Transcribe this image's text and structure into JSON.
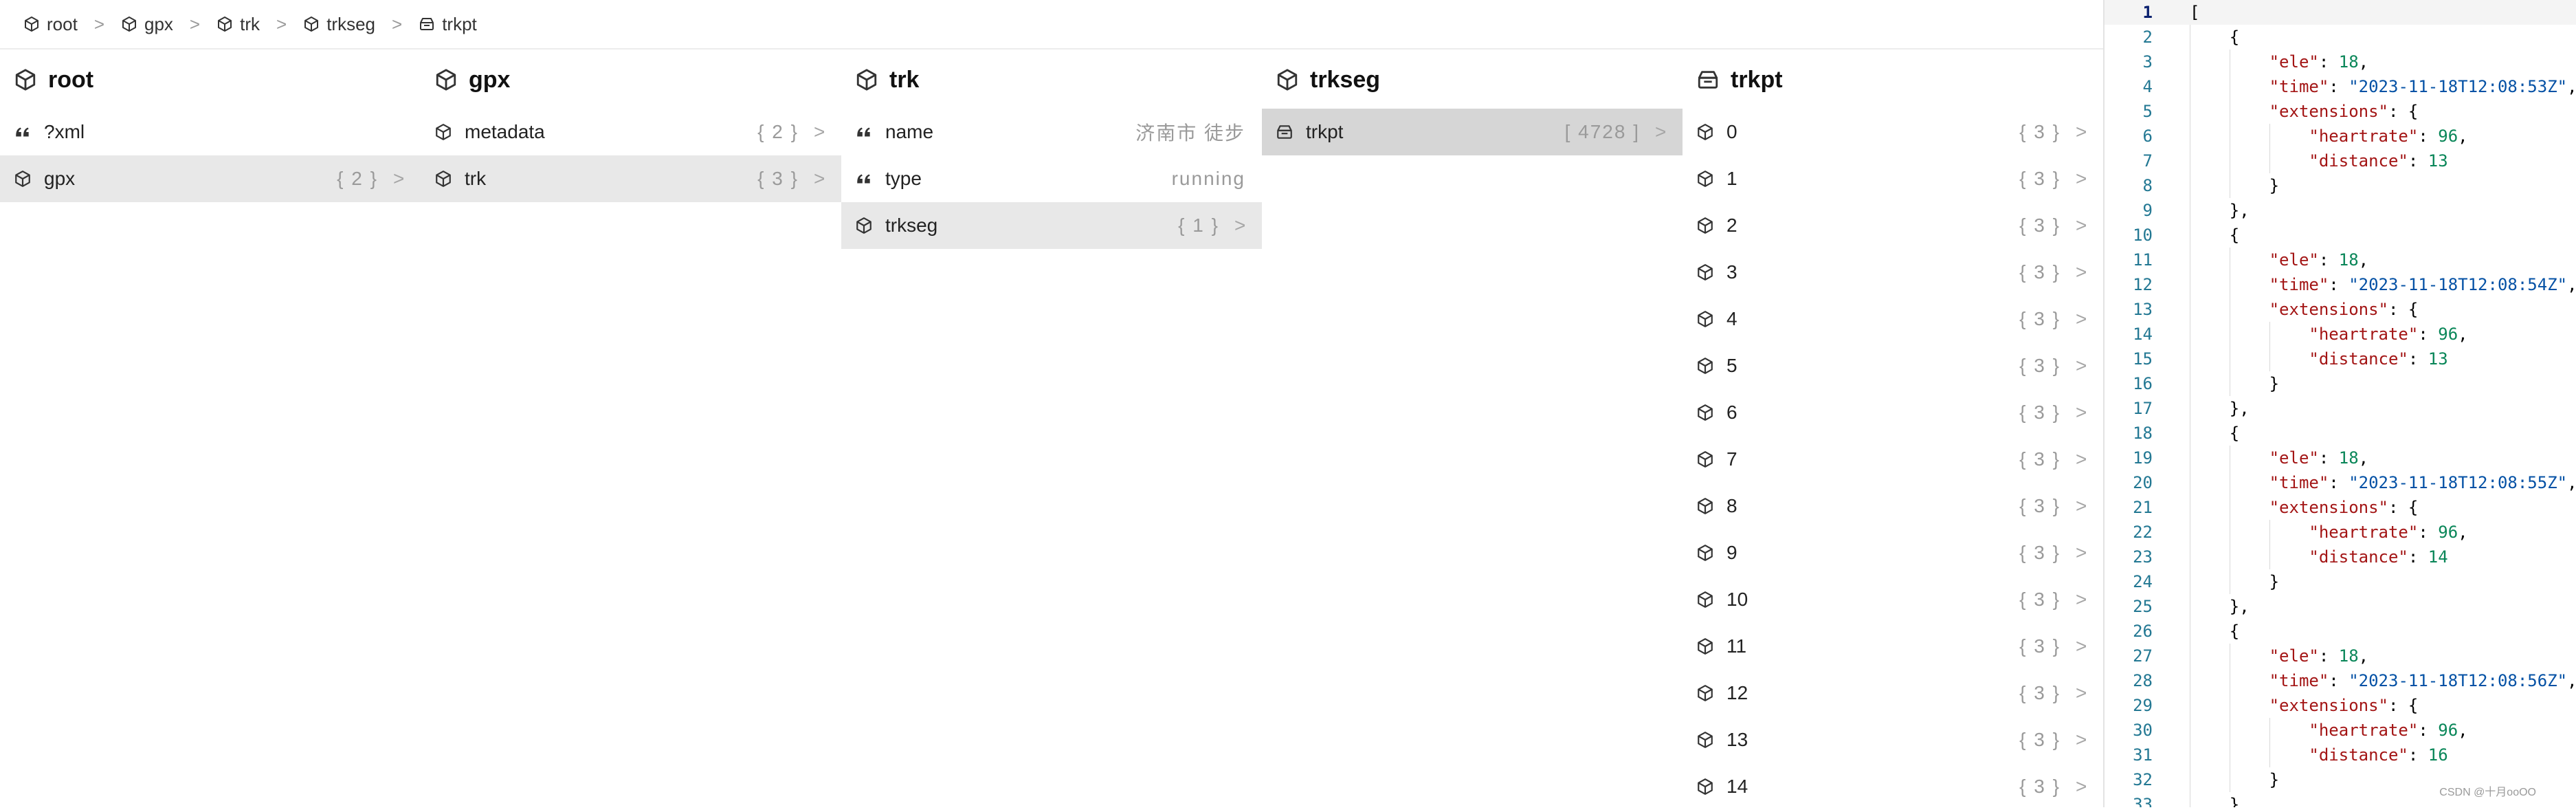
{
  "breadcrumb": [
    {
      "label": "root",
      "icon": "cube-icon"
    },
    {
      "label": "gpx",
      "icon": "cube-icon"
    },
    {
      "label": "trk",
      "icon": "cube-icon"
    },
    {
      "label": "trkseg",
      "icon": "cube-icon"
    },
    {
      "label": "trkpt",
      "icon": "stack-icon"
    }
  ],
  "breadcrumb_separator": ">",
  "columns": [
    {
      "title": "root",
      "icon": "cube-icon",
      "rows": [
        {
          "label": "?xml",
          "icon": "quote-icon",
          "meta": "",
          "chevron": false,
          "selected": ""
        },
        {
          "label": "gpx",
          "icon": "cube-icon",
          "meta": "{ 2 }",
          "chevron": true,
          "selected": "light"
        }
      ]
    },
    {
      "title": "gpx",
      "icon": "cube-icon",
      "rows": [
        {
          "label": "metadata",
          "icon": "cube-icon",
          "meta": "{ 2 }",
          "chevron": true,
          "selected": ""
        },
        {
          "label": "trk",
          "icon": "cube-icon",
          "meta": "{ 3 }",
          "chevron": true,
          "selected": "light"
        }
      ]
    },
    {
      "title": "trk",
      "icon": "cube-icon",
      "rows": [
        {
          "label": "name",
          "icon": "quote-icon",
          "meta": "济南市 徒步",
          "chevron": false,
          "selected": ""
        },
        {
          "label": "type",
          "icon": "quote-icon",
          "meta": "running",
          "chevron": false,
          "selected": ""
        },
        {
          "label": "trkseg",
          "icon": "cube-icon",
          "meta": "{ 1 }",
          "chevron": true,
          "selected": "light"
        }
      ]
    },
    {
      "title": "trkseg",
      "icon": "cube-icon",
      "rows": [
        {
          "label": "trkpt",
          "icon": "stack-icon",
          "meta": "[ 4728 ]",
          "chevron": true,
          "selected": "dark"
        }
      ]
    },
    {
      "title": "trkpt",
      "icon": "stack-icon",
      "rows": [
        {
          "label": "0",
          "icon": "cube-icon",
          "meta": "{ 3 }",
          "chevron": true,
          "selected": ""
        },
        {
          "label": "1",
          "icon": "cube-icon",
          "meta": "{ 3 }",
          "chevron": true,
          "selected": ""
        },
        {
          "label": "2",
          "icon": "cube-icon",
          "meta": "{ 3 }",
          "chevron": true,
          "selected": ""
        },
        {
          "label": "3",
          "icon": "cube-icon",
          "meta": "{ 3 }",
          "chevron": true,
          "selected": ""
        },
        {
          "label": "4",
          "icon": "cube-icon",
          "meta": "{ 3 }",
          "chevron": true,
          "selected": ""
        },
        {
          "label": "5",
          "icon": "cube-icon",
          "meta": "{ 3 }",
          "chevron": true,
          "selected": ""
        },
        {
          "label": "6",
          "icon": "cube-icon",
          "meta": "{ 3 }",
          "chevron": true,
          "selected": ""
        },
        {
          "label": "7",
          "icon": "cube-icon",
          "meta": "{ 3 }",
          "chevron": true,
          "selected": ""
        },
        {
          "label": "8",
          "icon": "cube-icon",
          "meta": "{ 3 }",
          "chevron": true,
          "selected": ""
        },
        {
          "label": "9",
          "icon": "cube-icon",
          "meta": "{ 3 }",
          "chevron": true,
          "selected": ""
        },
        {
          "label": "10",
          "icon": "cube-icon",
          "meta": "{ 3 }",
          "chevron": true,
          "selected": ""
        },
        {
          "label": "11",
          "icon": "cube-icon",
          "meta": "{ 3 }",
          "chevron": true,
          "selected": ""
        },
        {
          "label": "12",
          "icon": "cube-icon",
          "meta": "{ 3 }",
          "chevron": true,
          "selected": ""
        },
        {
          "label": "13",
          "icon": "cube-icon",
          "meta": "{ 3 }",
          "chevron": true,
          "selected": ""
        },
        {
          "label": "14",
          "icon": "cube-icon",
          "meta": "{ 3 }",
          "chevron": true,
          "selected": ""
        }
      ]
    }
  ],
  "row_chevron": ">",
  "code": {
    "active_line": 1,
    "lines": [
      {
        "n": "1",
        "indent": 0,
        "tokens": [
          [
            "p",
            "["
          ]
        ]
      },
      {
        "n": "2",
        "indent": 1,
        "tokens": [
          [
            "p",
            "{"
          ]
        ]
      },
      {
        "n": "3",
        "indent": 2,
        "tokens": [
          [
            "k",
            "\"ele\""
          ],
          [
            "p",
            ": "
          ],
          [
            "n",
            "18"
          ],
          [
            "p",
            ","
          ]
        ]
      },
      {
        "n": "4",
        "indent": 2,
        "tokens": [
          [
            "k",
            "\"time\""
          ],
          [
            "p",
            ": "
          ],
          [
            "s",
            "\"2023-11-18T12:08:53Z\""
          ],
          [
            "p",
            ","
          ]
        ]
      },
      {
        "n": "5",
        "indent": 2,
        "tokens": [
          [
            "k",
            "\"extensions\""
          ],
          [
            "p",
            ": {"
          ]
        ]
      },
      {
        "n": "6",
        "indent": 3,
        "tokens": [
          [
            "k",
            "\"heartrate\""
          ],
          [
            "p",
            ": "
          ],
          [
            "n",
            "96"
          ],
          [
            "p",
            ","
          ]
        ]
      },
      {
        "n": "7",
        "indent": 3,
        "tokens": [
          [
            "k",
            "\"distance\""
          ],
          [
            "p",
            ": "
          ],
          [
            "n",
            "13"
          ]
        ]
      },
      {
        "n": "8",
        "indent": 2,
        "tokens": [
          [
            "p",
            "}"
          ]
        ]
      },
      {
        "n": "9",
        "indent": 1,
        "tokens": [
          [
            "p",
            "},"
          ]
        ]
      },
      {
        "n": "10",
        "indent": 1,
        "tokens": [
          [
            "p",
            "{"
          ]
        ]
      },
      {
        "n": "11",
        "indent": 2,
        "tokens": [
          [
            "k",
            "\"ele\""
          ],
          [
            "p",
            ": "
          ],
          [
            "n",
            "18"
          ],
          [
            "p",
            ","
          ]
        ]
      },
      {
        "n": "12",
        "indent": 2,
        "tokens": [
          [
            "k",
            "\"time\""
          ],
          [
            "p",
            ": "
          ],
          [
            "s",
            "\"2023-11-18T12:08:54Z\""
          ],
          [
            "p",
            ","
          ]
        ]
      },
      {
        "n": "13",
        "indent": 2,
        "tokens": [
          [
            "k",
            "\"extensions\""
          ],
          [
            "p",
            ": {"
          ]
        ]
      },
      {
        "n": "14",
        "indent": 3,
        "tokens": [
          [
            "k",
            "\"heartrate\""
          ],
          [
            "p",
            ": "
          ],
          [
            "n",
            "96"
          ],
          [
            "p",
            ","
          ]
        ]
      },
      {
        "n": "15",
        "indent": 3,
        "tokens": [
          [
            "k",
            "\"distance\""
          ],
          [
            "p",
            ": "
          ],
          [
            "n",
            "13"
          ]
        ]
      },
      {
        "n": "16",
        "indent": 2,
        "tokens": [
          [
            "p",
            "}"
          ]
        ]
      },
      {
        "n": "17",
        "indent": 1,
        "tokens": [
          [
            "p",
            "},"
          ]
        ]
      },
      {
        "n": "18",
        "indent": 1,
        "tokens": [
          [
            "p",
            "{"
          ]
        ]
      },
      {
        "n": "19",
        "indent": 2,
        "tokens": [
          [
            "k",
            "\"ele\""
          ],
          [
            "p",
            ": "
          ],
          [
            "n",
            "18"
          ],
          [
            "p",
            ","
          ]
        ]
      },
      {
        "n": "20",
        "indent": 2,
        "tokens": [
          [
            "k",
            "\"time\""
          ],
          [
            "p",
            ": "
          ],
          [
            "s",
            "\"2023-11-18T12:08:55Z\""
          ],
          [
            "p",
            ","
          ]
        ]
      },
      {
        "n": "21",
        "indent": 2,
        "tokens": [
          [
            "k",
            "\"extensions\""
          ],
          [
            "p",
            ": {"
          ]
        ]
      },
      {
        "n": "22",
        "indent": 3,
        "tokens": [
          [
            "k",
            "\"heartrate\""
          ],
          [
            "p",
            ": "
          ],
          [
            "n",
            "96"
          ],
          [
            "p",
            ","
          ]
        ]
      },
      {
        "n": "23",
        "indent": 3,
        "tokens": [
          [
            "k",
            "\"distance\""
          ],
          [
            "p",
            ": "
          ],
          [
            "n",
            "14"
          ]
        ]
      },
      {
        "n": "24",
        "indent": 2,
        "tokens": [
          [
            "p",
            "}"
          ]
        ]
      },
      {
        "n": "25",
        "indent": 1,
        "tokens": [
          [
            "p",
            "},"
          ]
        ]
      },
      {
        "n": "26",
        "indent": 1,
        "tokens": [
          [
            "p",
            "{"
          ]
        ]
      },
      {
        "n": "27",
        "indent": 2,
        "tokens": [
          [
            "k",
            "\"ele\""
          ],
          [
            "p",
            ": "
          ],
          [
            "n",
            "18"
          ],
          [
            "p",
            ","
          ]
        ]
      },
      {
        "n": "28",
        "indent": 2,
        "tokens": [
          [
            "k",
            "\"time\""
          ],
          [
            "p",
            ": "
          ],
          [
            "s",
            "\"2023-11-18T12:08:56Z\""
          ],
          [
            "p",
            ","
          ]
        ]
      },
      {
        "n": "29",
        "indent": 2,
        "tokens": [
          [
            "k",
            "\"extensions\""
          ],
          [
            "p",
            ": {"
          ]
        ]
      },
      {
        "n": "30",
        "indent": 3,
        "tokens": [
          [
            "k",
            "\"heartrate\""
          ],
          [
            "p",
            ": "
          ],
          [
            "n",
            "96"
          ],
          [
            "p",
            ","
          ]
        ]
      },
      {
        "n": "31",
        "indent": 3,
        "tokens": [
          [
            "k",
            "\"distance\""
          ],
          [
            "p",
            ": "
          ],
          [
            "n",
            "16"
          ]
        ]
      },
      {
        "n": "32",
        "indent": 2,
        "tokens": [
          [
            "p",
            "}"
          ]
        ]
      },
      {
        "n": "33",
        "indent": 1,
        "tokens": [
          [
            "p",
            "},"
          ]
        ]
      }
    ]
  },
  "watermark": "CSDN @十月ooOO",
  "colors": {
    "selected_row": "#e8e8e8",
    "selected_row_dark": "#d6d6d6",
    "json_key": "#a31515",
    "json_string": "#0451a5",
    "json_number": "#098658",
    "line_number": "#237893"
  }
}
